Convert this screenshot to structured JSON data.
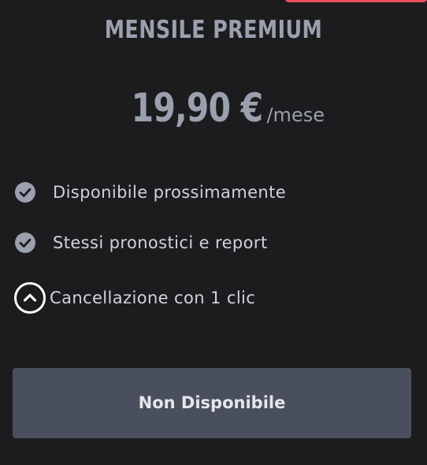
{
  "plan": {
    "title": "MENSILE PREMIUM",
    "price": "19,90 €",
    "period": "/mese"
  },
  "features": [
    {
      "text": "Disponibile prossimamente",
      "icon": "check-circle-icon"
    },
    {
      "text": "Stessi pronostici e report",
      "icon": "check-circle-icon"
    },
    {
      "text": "Cancellazione con 1 clic",
      "icon": "chevron-up-circle-icon"
    }
  ],
  "cta": {
    "label": "Non Disponibile"
  },
  "colors": {
    "background": "#1c1c1f",
    "title_text": "#9aa0ad",
    "feature_text": "#d0d3da",
    "check_icon": "#9aa0ad",
    "button_bg": "#4a4f5d",
    "accent": "#e8505b"
  }
}
